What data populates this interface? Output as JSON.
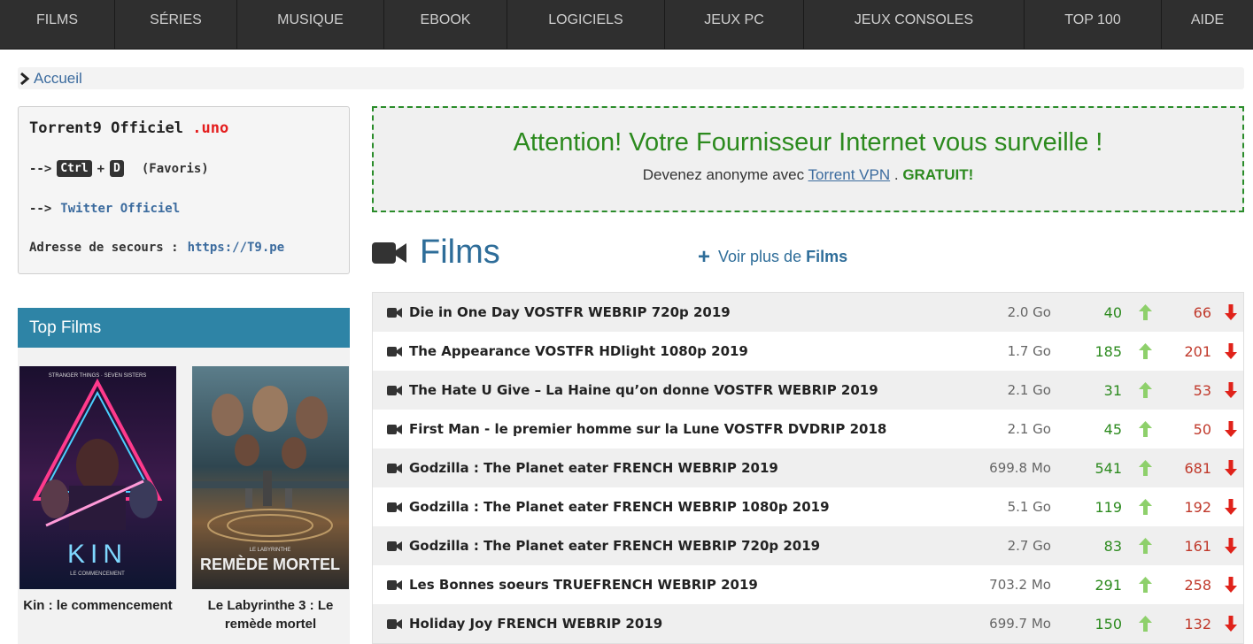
{
  "nav": [
    "Films",
    "Séries",
    "Musique",
    "Ebook",
    "Logiciels",
    "Jeux PC",
    "Jeux Consoles",
    "Top 100",
    "Aide"
  ],
  "breadcrumb": {
    "label": "Accueil"
  },
  "infobox": {
    "title": "Torrent9 Officiel",
    "tld": ".uno",
    "arrow": "-->",
    "key1": "Ctrl",
    "plus": "+",
    "key2": "D",
    "favoris": "(Favoris)",
    "twitter": "Twitter Officiel",
    "backup_label": "Adresse de secours :",
    "backup_url": "https://T9.pe"
  },
  "top_films": {
    "title": "Top Films",
    "items": [
      {
        "caption": "Kin : le commencement",
        "poster_title": "KIN",
        "poster_sub": "LE COMMENCEMENT",
        "poster_top": "STRANGER THINGS · SEVEN SISTERS"
      },
      {
        "caption": "Le Labyrinthe 3 : Le remède mortel",
        "poster_title": "REMÈDE MORTEL",
        "poster_sub": "LE LABYRINTHE"
      }
    ]
  },
  "warning": {
    "headline": "Attention! Votre Fournisseur Internet vous surveille !",
    "prefix": "Devenez anonyme avec",
    "vpn": "Torrent VPN",
    "sep": ".",
    "free": "GRATUIT!"
  },
  "section": {
    "title": "Films",
    "more_prefix": "Voir plus de",
    "more_strong": "Films"
  },
  "torrents": [
    {
      "name": "Die in One Day VOSTFR WEBRIP 720p 2019",
      "size": "2.0 Go",
      "seeders": "40",
      "leechers": "66"
    },
    {
      "name": "The Appearance VOSTFR HDlight 1080p 2019",
      "size": "1.7 Go",
      "seeders": "185",
      "leechers": "201"
    },
    {
      "name": "The Hate U Give – La Haine qu’on donne VOSTFR WEBRIP 2019",
      "size": "2.1 Go",
      "seeders": "31",
      "leechers": "53"
    },
    {
      "name": "First Man - le premier homme sur la Lune VOSTFR DVDRIP 2018",
      "size": "2.1 Go",
      "seeders": "45",
      "leechers": "50"
    },
    {
      "name": "Godzilla : The Planet eater FRENCH WEBRIP 2019",
      "size": "699.8 Mo",
      "seeders": "541",
      "leechers": "681"
    },
    {
      "name": "Godzilla : The Planet eater FRENCH WEBRIP 1080p 2019",
      "size": "5.1 Go",
      "seeders": "119",
      "leechers": "192"
    },
    {
      "name": "Godzilla : The Planet eater FRENCH WEBRIP 720p 2019",
      "size": "2.7 Go",
      "seeders": "83",
      "leechers": "161"
    },
    {
      "name": "Les Bonnes soeurs TRUEFRENCH WEBRIP 2019",
      "size": "703.2 Mo",
      "seeders": "291",
      "leechers": "258"
    },
    {
      "name": "Holiday Joy FRENCH WEBRIP 2019",
      "size": "699.7 Mo",
      "seeders": "150",
      "leechers": "132"
    }
  ],
  "colors": {
    "nav_bg": "#2f2f2f",
    "accent": "#2e84a6",
    "seed": "#2c8a1e",
    "leech": "#c0392b",
    "link": "#3b6b9e"
  }
}
